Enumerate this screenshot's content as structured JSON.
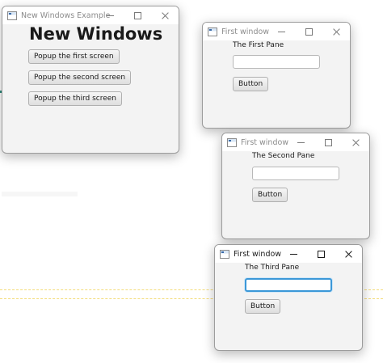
{
  "main_window": {
    "title": "New Windows Example",
    "heading": "New Windows",
    "buttons": [
      {
        "label": "Popup the first screen"
      },
      {
        "label": "Popup the second screen"
      },
      {
        "label": "Popup the third screen"
      }
    ]
  },
  "popup_windows": [
    {
      "title": "First window",
      "pane_label": "The First Pane",
      "field_value": "",
      "button_label": "Button"
    },
    {
      "title": "First window",
      "pane_label": "The Second Pane",
      "field_value": "",
      "button_label": "Button"
    },
    {
      "title": "First window",
      "pane_label": "The Third Pane",
      "field_value": "",
      "button_label": "Button"
    }
  ],
  "colors": {
    "focus_accent": "#3b98d8",
    "window_background": "#f3f3f3",
    "inactive_title": "#8c8c8c"
  }
}
